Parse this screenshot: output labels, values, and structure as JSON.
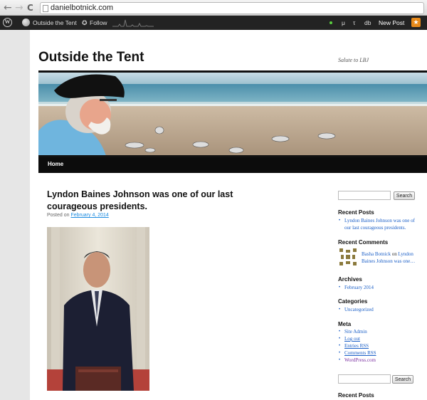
{
  "browser": {
    "url": "danielbotnick.com",
    "back_icon": "←",
    "forward_icon": "→",
    "reload_icon": "C"
  },
  "adminbar": {
    "wp_logo": "W",
    "site_name": "Outside the Tent",
    "follow_icon": "✪",
    "follow_label": "Follow",
    "mu": "μ",
    "tau": "τ",
    "db": "db",
    "new_post": "New Post",
    "new_post_icon": "★",
    "status_color": "#5bd13f"
  },
  "site": {
    "title": "Outside the Tent",
    "description": "Salute to LBJ"
  },
  "nav": {
    "home": "Home"
  },
  "post": {
    "title_line1": "Lyndon Baines Johnson was one of our last",
    "title_line2": "courageous presidents.",
    "posted_on": "Posted on",
    "date": "February 4, 2014"
  },
  "sidebar": {
    "search_button": "Search",
    "recent_posts_title": "Recent Posts",
    "recent_post_line1": "Lyndon Baines Johnson was one of",
    "recent_post_line2": "our last courageous presidents.",
    "recent_comments_title": "Recent Comments",
    "comment_author": "Basha Botnick",
    "comment_on": "on",
    "comment_post_line1": "Lyndon",
    "comment_post_line2": "Baines Johnson was one…",
    "archives_title": "Archives",
    "archive_month": "February 2014",
    "categories_title": "Categories",
    "category": "Uncategorized",
    "meta_title": "Meta",
    "meta_links": [
      "Site Admin",
      "Log out",
      "Entries RSS",
      "Comments RSS",
      "WordPress.com"
    ],
    "search_button_2": "Search",
    "recent_posts_title_2": "Recent Posts"
  },
  "colors": {
    "link": "#1b5fc7",
    "nav_bar": "#0c0c0c",
    "admin_bar": "#232323",
    "new_post_accent": "#e88a1a"
  }
}
